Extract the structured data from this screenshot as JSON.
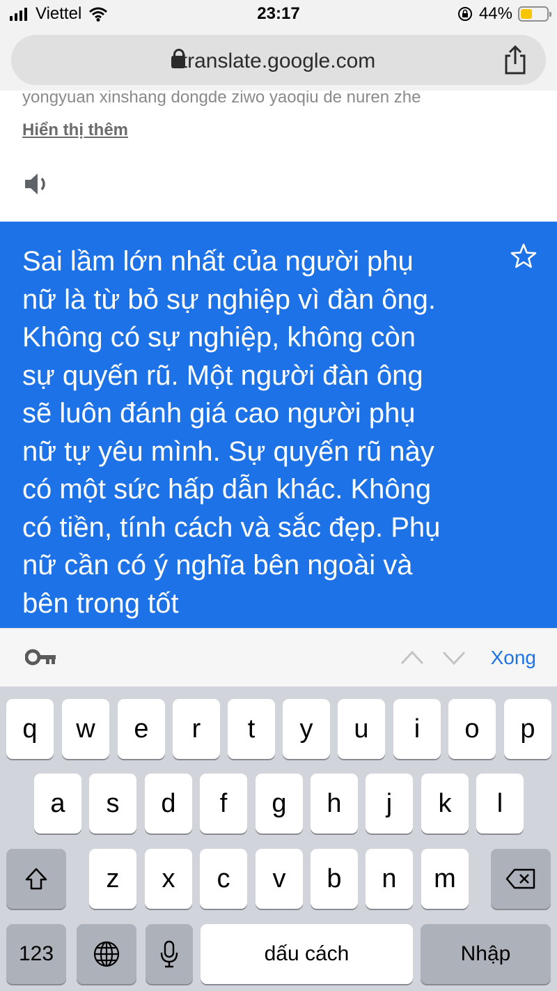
{
  "status_bar": {
    "carrier": "Viettel",
    "time": "23:17",
    "battery_percent": "44%",
    "battery_level": 0.44
  },
  "browser": {
    "url": "translate.google.com"
  },
  "source": {
    "romanization": "yongyuan xinshang dongde ziwo yaoqiu de nuren zhe",
    "show_more": "Hiển thị thêm"
  },
  "translation": {
    "lines": [
      "Sai lầm lớn nhất của người phụ",
      "nữ là từ bỏ sự nghiệp vì đàn ông.",
      "Không có sự nghiệp, không còn",
      "sự quyến rũ. Một người đàn ông",
      "sẽ luôn đánh giá cao người phụ",
      "nữ tự yêu mình. Sự quyến rũ này",
      "có một sức hấp dẫn khác. Không",
      "có tiền, tính cách và sắc đẹp. Phụ",
      "nữ cần có ý nghĩa bên ngoài và",
      "bên trong tốt"
    ]
  },
  "accessory_bar": {
    "done_label": "Xong"
  },
  "keyboard": {
    "row1": [
      "q",
      "w",
      "e",
      "r",
      "t",
      "y",
      "u",
      "i",
      "o",
      "p"
    ],
    "row2": [
      "a",
      "s",
      "d",
      "f",
      "g",
      "h",
      "j",
      "k",
      "l"
    ],
    "row3": [
      "z",
      "x",
      "c",
      "v",
      "b",
      "n",
      "m"
    ],
    "numbers_label": "123",
    "space_label": "dấu cách",
    "return_label": "Nhập"
  },
  "colors": {
    "accent": "#1d72e8",
    "keyboard_bg": "#d1d4da",
    "battery": "#f7c600"
  },
  "icons": [
    "wifi-icon",
    "lock-icon",
    "share-icon",
    "speaker-icon",
    "star-icon",
    "key-icon",
    "chevron-up-icon",
    "chevron-down-icon",
    "shift-icon",
    "delete-icon",
    "globe-icon",
    "microphone-icon",
    "portrait-lock-icon"
  ]
}
